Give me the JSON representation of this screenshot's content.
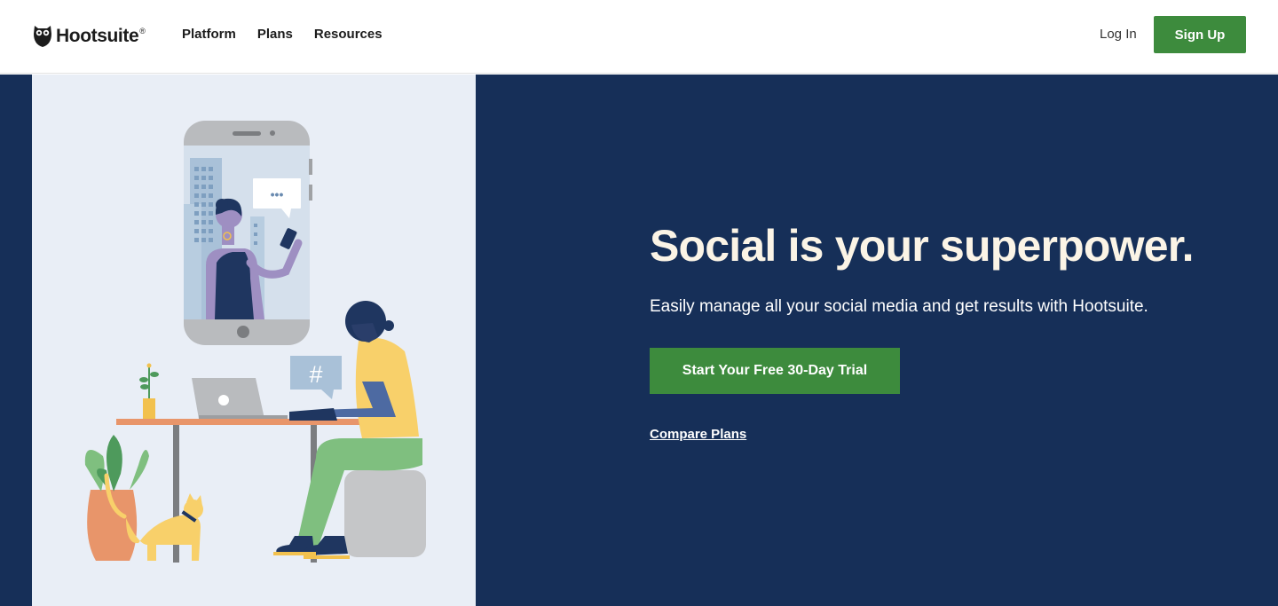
{
  "header": {
    "logo_text": "Hootsuite",
    "logo_mark": "®",
    "nav": [
      {
        "label": "Platform"
      },
      {
        "label": "Plans"
      },
      {
        "label": "Resources"
      }
    ],
    "login_label": "Log In",
    "signup_label": "Sign Up"
  },
  "hero": {
    "headline": "Social is your superpower.",
    "subtext": "Easily manage all your social media and get results with Hootsuite.",
    "cta_label": "Start Your Free 30-Day Trial",
    "compare_label": "Compare Plans",
    "illustration": {
      "chat_bubble": "•••",
      "hashtag_bubble": "#"
    }
  },
  "colors": {
    "brand_green": "#3d8b3d",
    "hero_navy": "#162f58",
    "illustration_bg": "#e9eef6",
    "headline_cream": "#fbf4e6"
  },
  "icons": [
    "owl-logo-icon"
  ]
}
